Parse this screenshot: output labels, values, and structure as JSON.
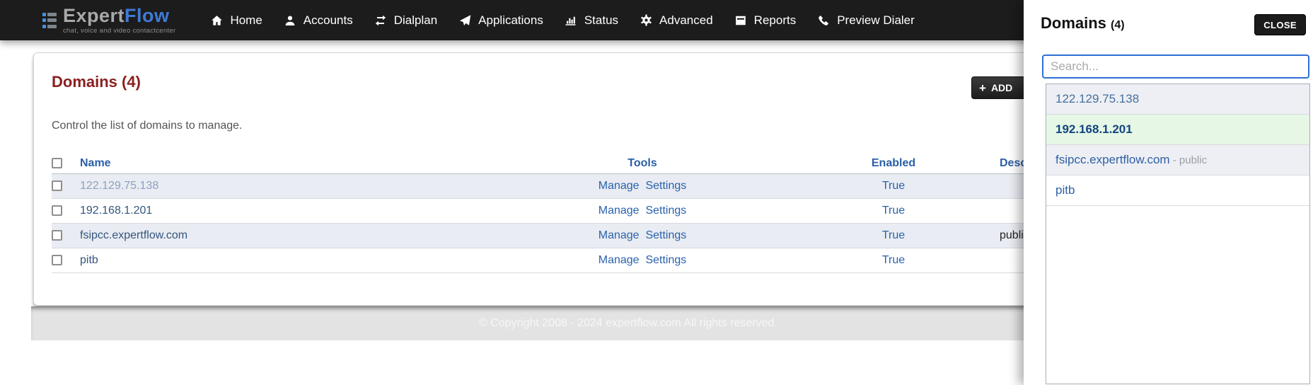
{
  "brand": {
    "name_primary": "Expert",
    "name_secondary": "Flow",
    "tagline": "chat, voice and video contactcenter"
  },
  "nav": {
    "items": [
      {
        "label": "Home",
        "icon": "home-icon"
      },
      {
        "label": "Accounts",
        "icon": "user-icon"
      },
      {
        "label": "Dialplan",
        "icon": "exchange-icon"
      },
      {
        "label": "Applications",
        "icon": "paper-plane-icon"
      },
      {
        "label": "Status",
        "icon": "bar-chart-icon"
      },
      {
        "label": "Advanced",
        "icon": "gear-icon"
      },
      {
        "label": "Reports",
        "icon": "book-icon"
      },
      {
        "label": "Preview Dialer",
        "icon": "phone-icon"
      }
    ]
  },
  "page": {
    "heading": "Domains (4)",
    "subtitle": "Control the list of domains to manage.",
    "add_plus": "+",
    "add_button": "ADD",
    "table": {
      "headers": {
        "name": "Name",
        "tools": "Tools",
        "enabled": "Enabled",
        "description": "Description"
      },
      "rows": [
        {
          "name": "122.129.75.138",
          "manage": "Manage",
          "settings": "Settings",
          "enabled": "True",
          "description": ""
        },
        {
          "name": "192.168.1.201",
          "manage": "Manage",
          "settings": "Settings",
          "enabled": "True",
          "description": ""
        },
        {
          "name": "fsipcc.expertflow.com",
          "manage": "Manage",
          "settings": "Settings",
          "enabled": "True",
          "description": "public"
        },
        {
          "name": "pitb",
          "manage": "Manage",
          "settings": "Settings",
          "enabled": "True",
          "description": ""
        }
      ]
    },
    "footer": "© Copyright 2008 - 2024 expertflow.com All rights reserved."
  },
  "panel": {
    "title": "Domains",
    "count": "(4)",
    "close_button": "CLOSE",
    "search_placeholder": "Search...",
    "items": [
      {
        "label": "122.129.75.138",
        "suffix": ""
      },
      {
        "label": "192.168.1.201",
        "suffix": ""
      },
      {
        "label": "fsipcc.expertflow.com",
        "suffix": " - public"
      },
      {
        "label": "pitb",
        "suffix": ""
      }
    ]
  },
  "colors": {
    "navbar_bg": "#1c1c1c",
    "brand_blue": "#3f7ad6",
    "heading_red": "#8b2020",
    "link_blue": "#2a62ad",
    "header_blue": "#2a5fa8",
    "row_alt_bg": "#e9ecf2",
    "selected_item_bg": "#e7f7e6",
    "search_border_blue": "#2e6fd2",
    "footer_bg": "#e3e3e3"
  }
}
